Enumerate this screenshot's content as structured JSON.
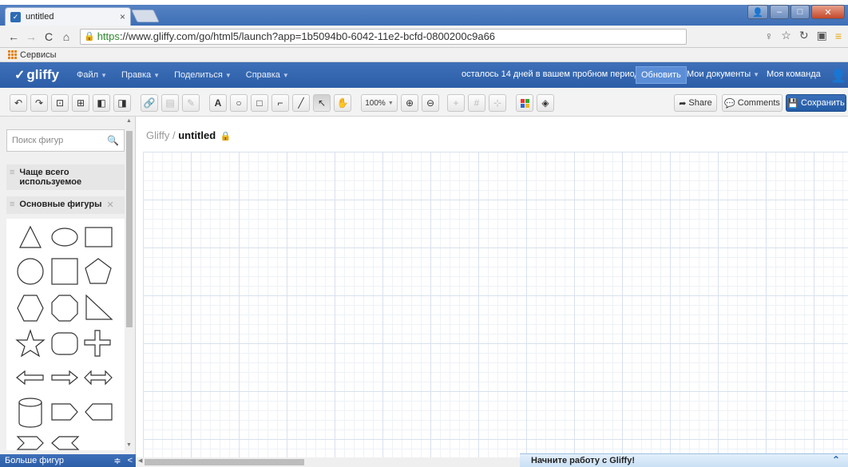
{
  "browser": {
    "tab_title": "untitled",
    "tab_close": "×",
    "url_https": "https",
    "url_rest": "://www.gliffy.com/go/html5/launch?app=1b5094b0-6042-11e2-bcfd-0800200c9a66",
    "bookmarks_label": "Сервисы"
  },
  "menubar": {
    "logo_text": "gliffy",
    "items": [
      "Файл",
      "Правка",
      "Поделиться",
      "Справка"
    ],
    "trial_text": "осталось 14 дней в вашем пробном периоде",
    "upgrade_label": "Обновить",
    "my_documents": "Мои документы",
    "my_team": "Моя команда"
  },
  "toolbar": {
    "text_tool": "A",
    "zoom": "100%",
    "share_label": "Share",
    "comments_label": "Comments",
    "save_label": "Сохранить"
  },
  "leftpanel": {
    "search_placeholder": "Поиск фигур",
    "section_frequent": "Чаще всего используемое",
    "section_basic": "Основные фигуры",
    "more_shapes": "Больше фигур"
  },
  "canvas": {
    "brand": "Gliffy",
    "separator": " / ",
    "doc_name": "untitled"
  },
  "footer": {
    "get_started": "Начните работу с Gliffy!"
  },
  "colors": {
    "brand_blue": "#2c5ea8",
    "upgrade_blue": "#5b8ed6",
    "lock_gold": "#e0a100"
  }
}
